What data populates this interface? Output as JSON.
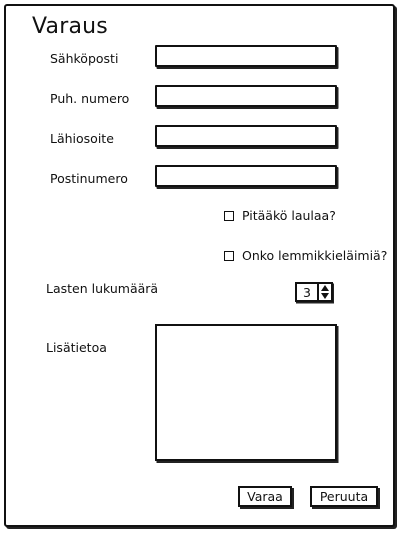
{
  "form": {
    "title": "Varaus",
    "email_label": "Sähköposti",
    "phone_label": "Puh. numero",
    "address_label": "Lähiosoite",
    "postal_label": "Postinumero",
    "email_value": "",
    "phone_value": "",
    "address_value": "",
    "postal_value": "",
    "sing_checkbox_label": "Pitääkö laulaa?",
    "pets_checkbox_label": "Onko lemmikkieläimiä?",
    "children_label": "Lasten lukumäärä",
    "children_value": "3",
    "info_label": "Lisätietoa",
    "info_value": "",
    "book_button": "Varaa",
    "cancel_button": "Peruuta"
  },
  "icons": {
    "stepper_up": "arrow-up-icon",
    "stepper_down": "arrow-down-icon"
  },
  "colors": {
    "ink": "#111111",
    "background": "#ffffff"
  }
}
